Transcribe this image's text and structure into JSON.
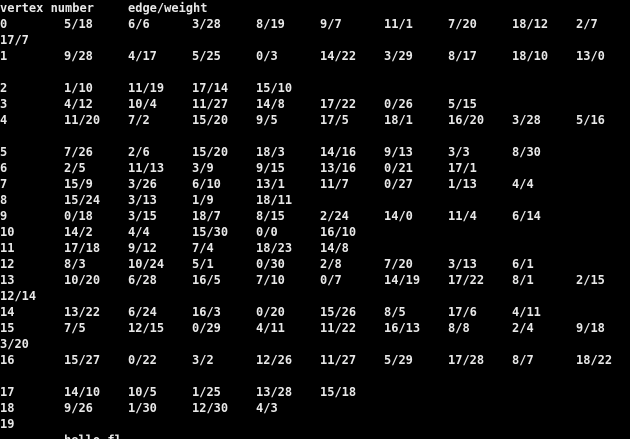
{
  "console": {
    "lines": [
      [
        "vertex number",
        "edge/weight"
      ],
      [
        "0",
        "5/18",
        "6/6",
        "3/28",
        "8/19",
        "9/7",
        "11/1",
        "7/20",
        "18/12",
        "2/7"
      ],
      [
        "17/7"
      ],
      [
        "1",
        "9/28",
        "4/17",
        "5/25",
        "0/3",
        "14/22",
        "3/29",
        "8/17",
        "18/10",
        "13/0"
      ],
      [],
      [
        "2",
        "1/10",
        "11/19",
        "17/14",
        "15/10"
      ],
      [
        "3",
        "4/12",
        "10/4",
        "11/27",
        "14/8",
        "17/22",
        "0/26",
        "5/15"
      ],
      [
        "4",
        "11/20",
        "7/2",
        "15/20",
        "9/5",
        "17/5",
        "18/1",
        "16/20",
        "3/28",
        "5/16"
      ],
      [],
      [
        "5",
        "7/26",
        "2/6",
        "15/20",
        "18/3",
        "14/16",
        "9/13",
        "3/3",
        "8/30"
      ],
      [
        "6",
        "2/5",
        "11/13",
        "3/9",
        "9/15",
        "13/16",
        "0/21",
        "17/1"
      ],
      [
        "7",
        "15/9",
        "3/26",
        "6/10",
        "13/1",
        "11/7",
        "0/27",
        "1/13",
        "4/4"
      ],
      [
        "8",
        "15/24",
        "3/13",
        "1/9",
        "18/11"
      ],
      [
        "9",
        "0/18",
        "3/15",
        "18/7",
        "8/15",
        "2/24",
        "14/0",
        "11/4",
        "6/14"
      ],
      [
        "10",
        "14/2",
        "4/4",
        "15/30",
        "0/0",
        "16/10"
      ],
      [
        "11",
        "17/18",
        "9/12",
        "7/4",
        "18/23",
        "14/8"
      ],
      [
        "12",
        "8/3",
        "10/24",
        "5/1",
        "0/30",
        "2/8",
        "7/20",
        "3/13",
        "6/1"
      ],
      [
        "13",
        "10/20",
        "6/28",
        "16/5",
        "7/10",
        "0/7",
        "14/19",
        "17/22",
        "8/1",
        "2/15"
      ],
      [
        "12/14"
      ],
      [
        "14",
        "13/22",
        "6/24",
        "16/3",
        "0/20",
        "15/26",
        "8/5",
        "17/6",
        "4/11"
      ],
      [
        "15",
        "7/5",
        "12/15",
        "0/29",
        "4/11",
        "11/22",
        "16/13",
        "8/8",
        "2/4",
        "9/18"
      ],
      [
        "3/20"
      ],
      [
        "16",
        "15/27",
        "0/22",
        "3/2",
        "12/26",
        "11/27",
        "5/29",
        "17/28",
        "8/7",
        "18/22"
      ],
      [],
      [
        "17",
        "14/10",
        "10/5",
        "1/25",
        "13/28",
        "15/18"
      ],
      [
        "18",
        "9/26",
        "1/30",
        "12/30",
        "4/3"
      ],
      [
        "19"
      ],
      [
        "",
        "hello fl"
      ]
    ]
  }
}
